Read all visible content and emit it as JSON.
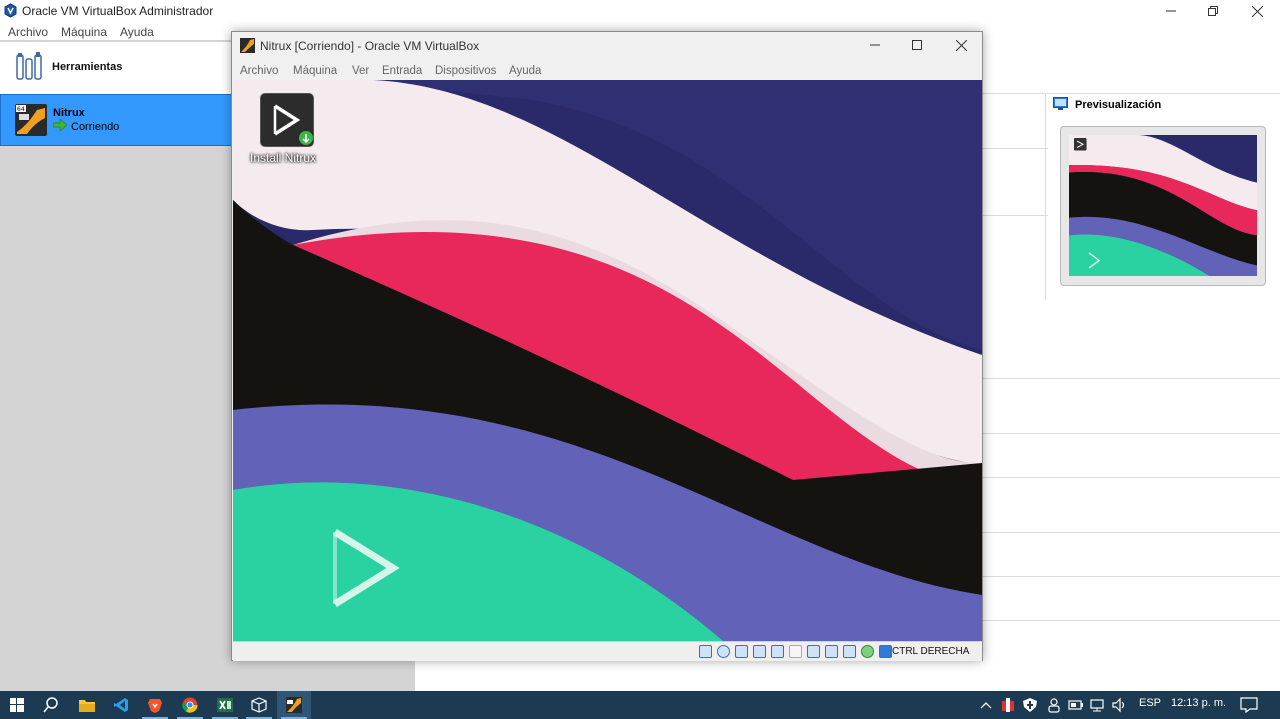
{
  "manager": {
    "title": "Oracle VM VirtualBox Administrador",
    "menu": [
      "Archivo",
      "Máquina",
      "Ayuda"
    ],
    "tools_label": "Herramientas",
    "vm_name": "Nitrux",
    "vm_state": "Corriendo",
    "preview_label": "Previsualización"
  },
  "vm_window": {
    "title": "Nitrux [Corriendo] - Oracle VM VirtualBox",
    "menu": [
      "Archivo",
      "Máquina",
      "Ver",
      "Entrada",
      "Dispositivos",
      "Ayuda"
    ],
    "desktop_icon_label": "Install Nitrux",
    "host_key": "CTRL DERECHA"
  },
  "taskbar": {
    "language": "ESP",
    "time": "12:13 p. m."
  },
  "colors": {
    "wave_navy": "#2a2a6a",
    "wave_light": "#f5eaee",
    "wave_pink": "#e8285a",
    "wave_black": "#141310",
    "wave_purple": "#6262b8",
    "wave_teal": "#2ad2a2",
    "selection": "#3399ff",
    "taskbar": "#1c3b52"
  }
}
